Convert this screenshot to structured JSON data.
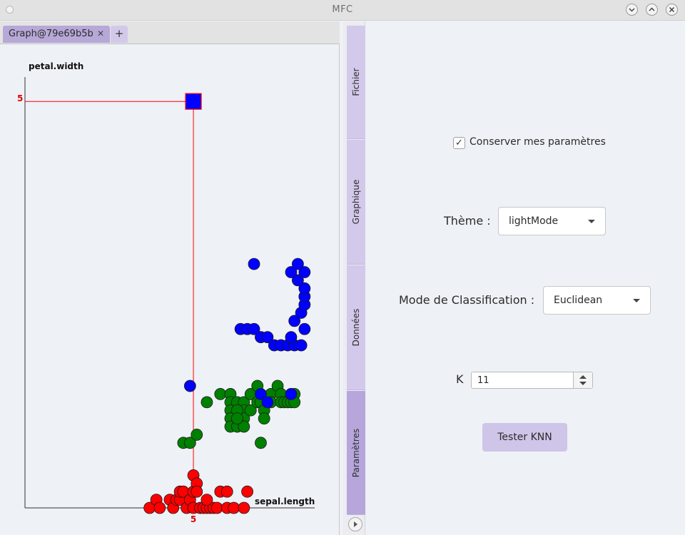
{
  "window": {
    "title": "MFC",
    "controls": [
      "chevron-down-icon",
      "chevron-up-icon",
      "close-icon"
    ]
  },
  "tabs": {
    "items": [
      {
        "label": "Graph@79e69b5b",
        "close": "✕"
      }
    ],
    "add_label": "+"
  },
  "side_tabs": [
    {
      "label": "Fichier",
      "active": false
    },
    {
      "label": "Graphique",
      "active": false
    },
    {
      "label": "Données",
      "active": false
    },
    {
      "label": "Paramètres",
      "active": true
    }
  ],
  "settings": {
    "keep_params": {
      "label": "Conserver mes paramètres",
      "checked": true,
      "mark": "✓"
    },
    "theme": {
      "label": "Thème :",
      "value": "lightMode"
    },
    "mode": {
      "label": "Mode de Classification :",
      "value": "Euclidean"
    },
    "k": {
      "label": "K",
      "value": "11"
    },
    "test_button": "Tester KNN"
  },
  "colors": {
    "accent": "#b6a6db",
    "class_red": "#ff0000",
    "class_green": "#008000",
    "class_blue": "#0000ff",
    "highlight": "#ff0000"
  },
  "chart_data": {
    "type": "scatter",
    "xlabel": "sepal.length",
    "ylabel": "petal.width",
    "xlim": [
      0,
      8.6
    ],
    "ylim": [
      0,
      5.3
    ],
    "xtick_labels": [
      "5"
    ],
    "ytick_labels": [
      "5"
    ],
    "highlight_tick_value": 5,
    "selected_point": {
      "x": 5,
      "y": 5,
      "marker": "square",
      "color": "#0000ff"
    },
    "series": [
      {
        "color": "#ff0000",
        "points": [
          [
            3.7,
            0
          ],
          [
            3.9,
            0.1
          ],
          [
            4.0,
            0
          ],
          [
            4.3,
            0.1
          ],
          [
            4.4,
            0
          ],
          [
            4.5,
            0.1
          ],
          [
            4.6,
            0.1
          ],
          [
            4.6,
            0.2
          ],
          [
            4.7,
            0.2
          ],
          [
            4.8,
            0
          ],
          [
            4.9,
            0.1
          ],
          [
            5.0,
            0
          ],
          [
            5.0,
            0.4
          ],
          [
            5.0,
            0.2
          ],
          [
            5.1,
            0.3
          ],
          [
            5.1,
            0.2
          ],
          [
            5.2,
            0
          ],
          [
            5.3,
            0
          ],
          [
            5.4,
            0
          ],
          [
            5.5,
            0
          ],
          [
            5.6,
            0
          ],
          [
            5.7,
            0
          ],
          [
            5.8,
            0.2
          ],
          [
            6.0,
            0
          ],
          [
            6.2,
            0
          ],
          [
            6.5,
            0
          ],
          [
            6.6,
            0.2
          ],
          [
            6.0,
            0.2
          ],
          [
            5.4,
            0.1
          ]
        ]
      },
      {
        "color": "#008000",
        "points": [
          [
            4.7,
            0.8
          ],
          [
            4.9,
            0.8
          ],
          [
            5.1,
            0.9
          ],
          [
            5.4,
            1.3
          ],
          [
            5.8,
            1.4
          ],
          [
            6.1,
            1.4
          ],
          [
            6.1,
            1.3
          ],
          [
            6.1,
            1.2
          ],
          [
            6.1,
            1.1
          ],
          [
            6.1,
            1.0
          ],
          [
            6.3,
            1.3
          ],
          [
            6.3,
            1.0
          ],
          [
            6.5,
            1.3
          ],
          [
            6.5,
            1.2
          ],
          [
            6.5,
            1.1
          ],
          [
            6.5,
            1.0
          ],
          [
            6.3,
            1.2
          ],
          [
            6.3,
            1.1
          ],
          [
            6.7,
            1.4
          ],
          [
            6.7,
            1.2
          ],
          [
            6.9,
            1.5
          ],
          [
            6.9,
            1.3
          ],
          [
            7.0,
            1.3
          ],
          [
            7.0,
            0.8
          ],
          [
            7.1,
            1.2
          ],
          [
            7.1,
            1.1
          ],
          [
            7.3,
            1.4
          ],
          [
            7.3,
            1.3
          ],
          [
            7.5,
            1.5
          ],
          [
            7.6,
            1.4
          ],
          [
            7.6,
            1.3
          ],
          [
            7.7,
            1.3
          ],
          [
            7.8,
            1.3
          ],
          [
            7.9,
            1.3
          ],
          [
            7.9,
            1.4
          ],
          [
            8.0,
            1.4
          ],
          [
            8.0,
            1.3
          ]
        ]
      },
      {
        "color": "#0000ff",
        "points": [
          [
            4.9,
            1.5
          ],
          [
            6.4,
            2.2
          ],
          [
            6.6,
            2.2
          ],
          [
            6.8,
            2.2
          ],
          [
            7.0,
            2.1
          ],
          [
            7.2,
            2.1
          ],
          [
            7.4,
            2.0
          ],
          [
            7.6,
            2.0
          ],
          [
            7.8,
            2.0
          ],
          [
            8.0,
            2.0
          ],
          [
            8.2,
            2.0
          ],
          [
            7.9,
            2.1
          ],
          [
            8.0,
            2.3
          ],
          [
            8.2,
            2.4
          ],
          [
            8.3,
            2.5
          ],
          [
            8.3,
            2.6
          ],
          [
            8.3,
            2.7
          ],
          [
            8.1,
            2.8
          ],
          [
            8.3,
            2.9
          ],
          [
            8.1,
            3.0
          ],
          [
            7.9,
            2.9
          ],
          [
            6.8,
            3.0
          ],
          [
            7.0,
            1.4
          ],
          [
            7.2,
            1.3
          ],
          [
            7.9,
            1.4
          ],
          [
            8.3,
            2.2
          ]
        ]
      }
    ]
  }
}
